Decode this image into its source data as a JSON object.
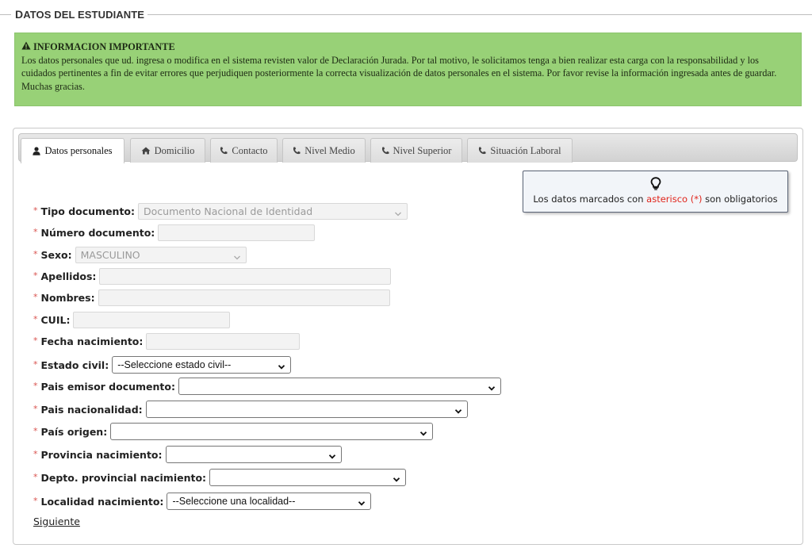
{
  "section": {
    "title_initial": "D",
    "title_rest": "ATOS DEL ESTUDIANTE",
    "title_second_initial": "E"
  },
  "alert": {
    "title": "INFORMACION IMPORTANTE",
    "body": "Los datos personales que ud. ingresa o modifica en el sistema revisten valor de Declaración Jurada. Por tal motivo, le solicitamos tenga a bien realizar esta carga con la responsabilidad y los cuidados pertinentes a fin de evitar errores que perjudiquen posteriormente la correcta visualización de datos personales en el sistema. Por favor revise la información ingresada antes de guardar. Muchas gracias.",
    "color": "#98d177"
  },
  "tabs": [
    {
      "label": "Datos personales",
      "icon": "user-icon",
      "active": true
    },
    {
      "label": "Domicilio",
      "icon": "home-icon",
      "active": false
    },
    {
      "label": "Contacto",
      "icon": "phone-icon",
      "active": false
    },
    {
      "label": "Nivel Medio",
      "icon": "phone-icon",
      "active": false
    },
    {
      "label": "Nivel Superior",
      "icon": "phone-icon",
      "active": false
    },
    {
      "label": "Situación Laboral",
      "icon": "phone-icon",
      "active": false
    }
  ],
  "note": {
    "icon": "lightbulb-icon",
    "text_before": "Los datos marcados con ",
    "text_red": "asterisco (*)",
    "text_after": " son obligatorios"
  },
  "form": {
    "required_mark": "*",
    "fields": {
      "tipo_documento": {
        "label": "Tipo documento:",
        "value": "Documento Nacional de Identidad"
      },
      "numero_documento": {
        "label": "Número documento:",
        "value": ""
      },
      "sexo": {
        "label": "Sexo:",
        "value": "MASCULINO"
      },
      "apellidos": {
        "label": "Apellidos:",
        "value": ""
      },
      "nombres": {
        "label": "Nombres:",
        "value": ""
      },
      "cuil": {
        "label": "CUIL:",
        "value": ""
      },
      "fecha_nacimiento": {
        "label": "Fecha nacimiento:",
        "value": ""
      },
      "estado_civil": {
        "label": "Estado civil:",
        "value": "--Seleccione estado civil--"
      },
      "pais_emisor": {
        "label": "Pais emisor documento:",
        "value": ""
      },
      "pais_nacionalidad": {
        "label": "Pais nacionalidad:",
        "value": ""
      },
      "pais_origen": {
        "label": "País origen:",
        "value": ""
      },
      "provincia_nacimiento": {
        "label": "Provincia nacimiento:",
        "value": ""
      },
      "depto_nacimiento": {
        "label": "Depto. provincial nacimiento:",
        "value": ""
      },
      "localidad_nacimiento": {
        "label": "Localidad nacimiento:",
        "value": "--Seleccione una localidad--"
      }
    },
    "next_link": "Siguiente"
  }
}
